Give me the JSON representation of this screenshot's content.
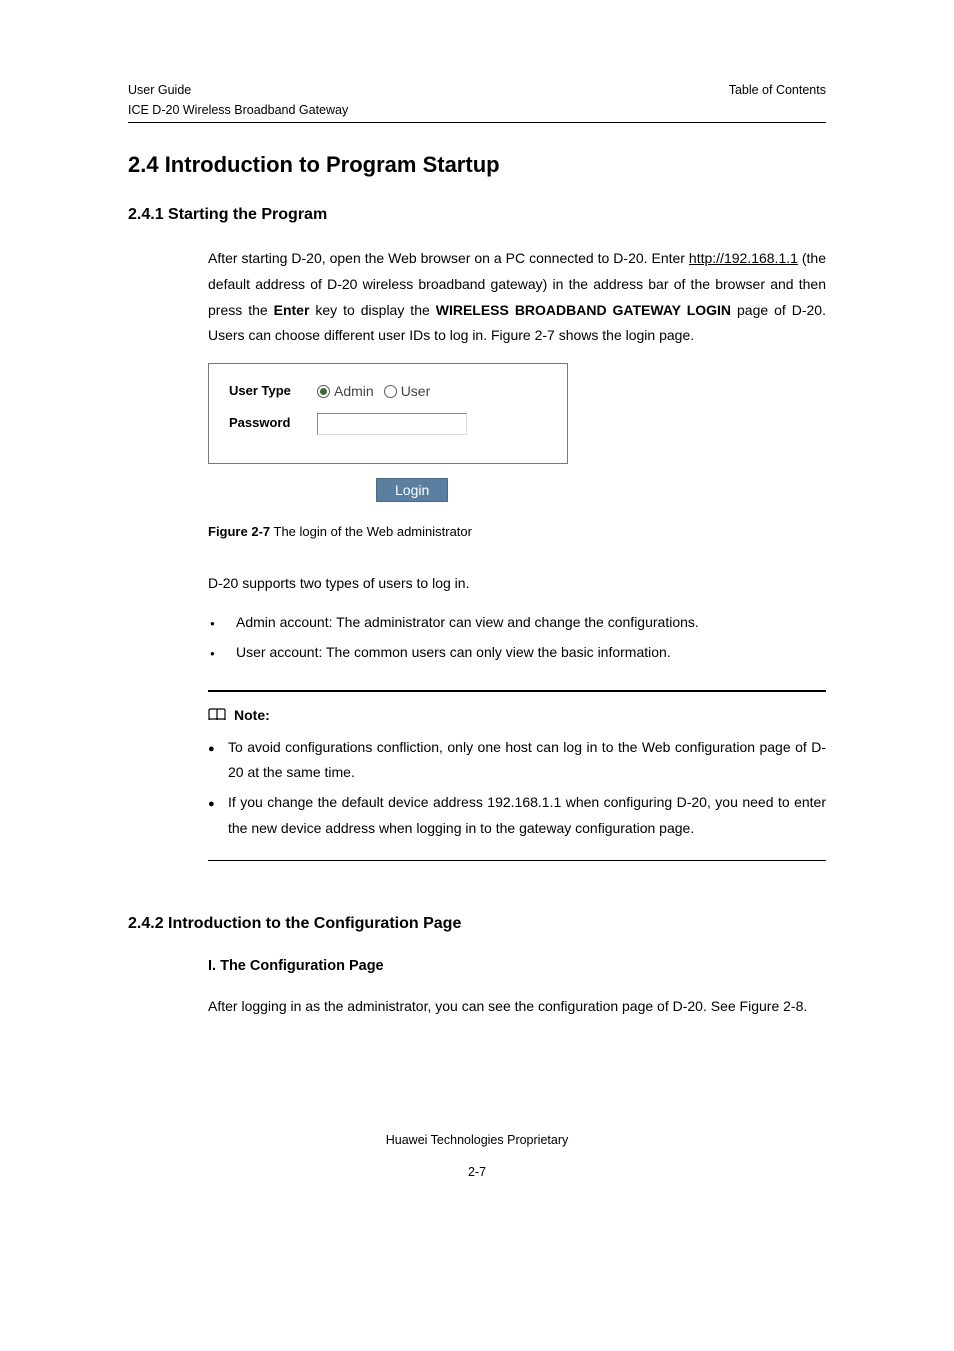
{
  "header": {
    "left_line1": "User Guide",
    "left_line2": "ICE D-20 Wireless Broadband Gateway",
    "right": "Table of Contents"
  },
  "section": {
    "h1": "2.4  Introduction to Program Startup",
    "h2a": "2.4.1  Starting the Program",
    "p1_pre": "After starting D-20, open the Web browser on a PC connected to D-20. Enter ",
    "p1_link": "http://192.168.1.1",
    "p1_post1": " (the default address of D-20 wireless broadband gateway) in the address bar of the browser and then press the ",
    "p1_b1": "Enter",
    "p1_post2": " key to display the ",
    "p1_b2": "WIRELESS BROADBAND GATEWAY LOGIN",
    "p1_post3": " page of D-20. Users can choose different user IDs to log in. Figure 2-7 shows the login page."
  },
  "login": {
    "user_type_label": "User Type",
    "password_label": "Password",
    "admin_label": "Admin",
    "user_label": "User",
    "login_btn": "Login"
  },
  "figure": {
    "label": "Figure 2-7",
    "caption": " The login of the Web administrator"
  },
  "body2": {
    "p1": "D-20 supports two types of users to log in.",
    "li1": "Admin account: The administrator can view and change the configurations.",
    "li2": "User account: The common users can only view the basic information."
  },
  "note": {
    "title": "Note:",
    "li1": "To avoid configurations confliction, only one host can log in to the Web configuration page of D-20 at the same time.",
    "li2": "If you change the default device address 192.168.1.1 when configuring D-20, you need to enter the new device address when logging in to the gateway configuration page."
  },
  "section2": {
    "h2": "2.4.2  Introduction to the Configuration Page",
    "h3": "I. The Configuration Page",
    "p1": "After logging in as the administrator, you can see the configuration page of D-20. See Figure 2-8."
  },
  "footer": {
    "line1": "Huawei Technologies Proprietary",
    "page": "2-7"
  }
}
